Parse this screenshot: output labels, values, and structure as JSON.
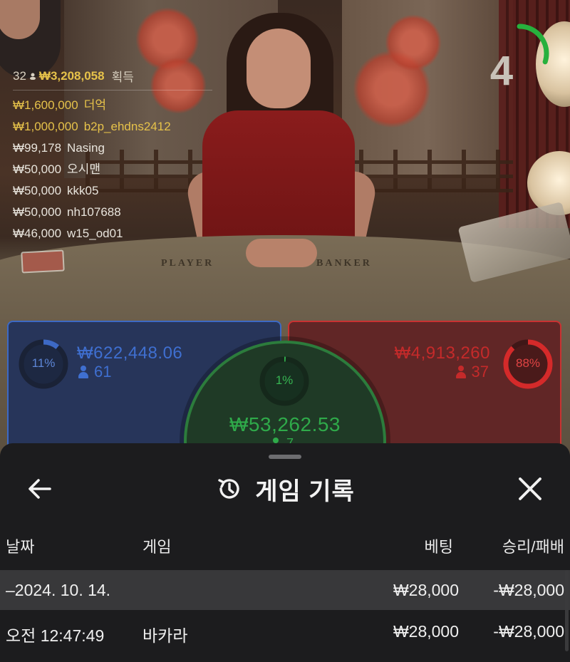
{
  "winners": {
    "header": {
      "count": "32",
      "total": "₩3,208,058",
      "label": "획득"
    },
    "rows": [
      {
        "amount": "₩1,600,000",
        "name": "더억",
        "tone": "gold"
      },
      {
        "amount": "₩1,000,000",
        "name": "b2p_ehdns2412",
        "tone": "gold"
      },
      {
        "amount": "₩99,178",
        "name": "Nasing",
        "tone": "white"
      },
      {
        "amount": "₩50,000",
        "name": "오시맨",
        "tone": "white"
      },
      {
        "amount": "₩50,000",
        "name": "kkk05",
        "tone": "white"
      },
      {
        "amount": "₩50,000",
        "name": "nh107688",
        "tone": "white"
      },
      {
        "amount": "₩46,000",
        "name": "w15_od01",
        "tone": "white"
      }
    ]
  },
  "countdown": {
    "value": "4",
    "fraction_remaining": 0.3,
    "color": "#27b03d"
  },
  "table_print": {
    "player": "PLAYER",
    "banker": "BANKER"
  },
  "bets": {
    "player": {
      "percent_label": "11%",
      "percent": 11,
      "pool": "₩622,448.06",
      "players": "61",
      "color": "#3d69c4"
    },
    "tie": {
      "percent_label": "1%",
      "percent": 1,
      "pool": "₩53,262.53",
      "players": "7",
      "color": "#2faa4a"
    },
    "banker": {
      "percent_label": "88%",
      "percent": 88,
      "pool": "₩4,913,260",
      "players": "37",
      "color": "#d42a2a"
    }
  },
  "sheet": {
    "title": "게임 기록",
    "icons": {
      "back": "back-arrow-icon",
      "history": "history-clock-icon",
      "close": "close-icon"
    },
    "columns": {
      "date": "날짜",
      "game": "게임",
      "bet": "베팅",
      "result": "승리/패배"
    },
    "date_row": {
      "date": "–2024. 10. 14.",
      "bet": "₩28,000",
      "result": "-₩28,000"
    },
    "game_row": {
      "time": "오전 12:47:49",
      "game": "바카라",
      "bet": "₩28,000",
      "result": "-₩28,000"
    }
  }
}
